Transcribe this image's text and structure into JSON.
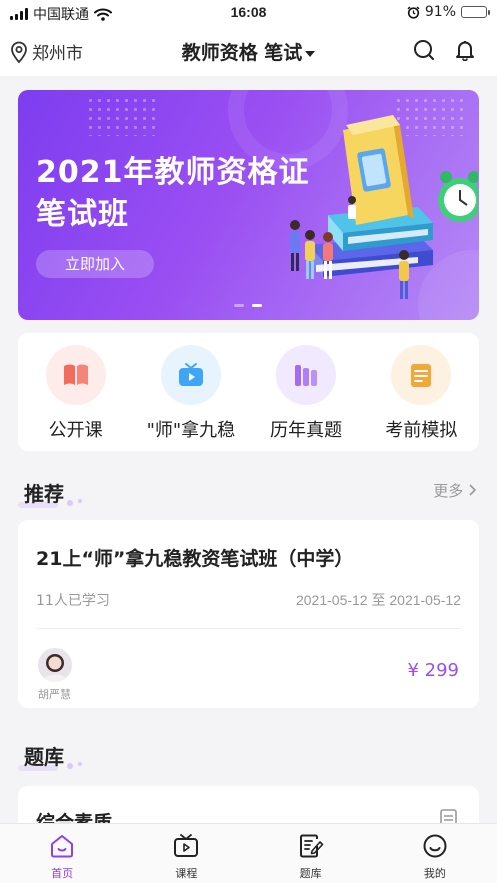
{
  "status_bar": {
    "carrier": "中国联通",
    "time": "16:08",
    "battery": "91%"
  },
  "header": {
    "location": "郑州市",
    "title": "教师资格 笔试"
  },
  "banner": {
    "headline_line1": "2021年教师资格证",
    "headline_line2": "笔试班",
    "button": "立即加入",
    "slides": 2,
    "active_slide": 2
  },
  "quick_links": [
    {
      "label": "公开课",
      "icon": "open-book-icon",
      "color": "#f26b5b",
      "bg": "#fdecea"
    },
    {
      "label": "\"师\"拿九稳",
      "icon": "tv-play-icon",
      "color": "#3ea6f5",
      "bg": "#e8f4fd"
    },
    {
      "label": "历年真题",
      "icon": "books-stack-icon",
      "color": "#a36cf2",
      "bg": "#f1e9fd"
    },
    {
      "label": "考前模拟",
      "icon": "notepad-icon",
      "color": "#f4a83a",
      "bg": "#fdf1e1"
    }
  ],
  "recommend": {
    "title": "推荐",
    "more": "更多",
    "course": {
      "title": "21上“师”拿九稳教资笔试班（中学）",
      "learners": "11人已学习",
      "dates": "2021-05-12 至 2021-05-12",
      "teacher": "胡严慧",
      "price": "¥ 299"
    }
  },
  "question_bank": {
    "title": "题库",
    "first_card": "综合素质"
  },
  "tabbar": [
    {
      "label": "首页",
      "icon": "home-icon",
      "active": true
    },
    {
      "label": "课程",
      "icon": "tv-icon",
      "active": false
    },
    {
      "label": "题库",
      "icon": "edit-note-icon",
      "active": false
    },
    {
      "label": "我的",
      "icon": "smile-icon",
      "active": false
    }
  ],
  "colors": {
    "accent": "#8f3ef0",
    "banner_from": "#7d3df0",
    "banner_to": "#b58af6"
  }
}
